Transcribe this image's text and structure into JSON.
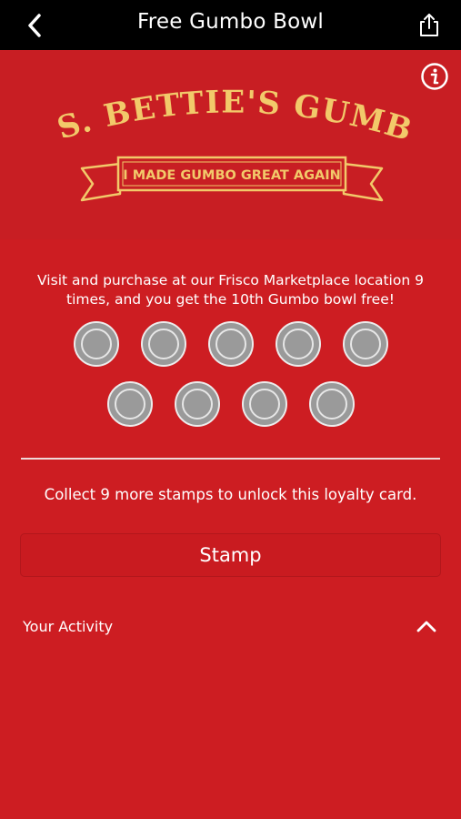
{
  "header": {
    "title": "Free Gumbo Bowl",
    "back_icon": "chevron-left-icon",
    "share_icon": "share-icon"
  },
  "banner": {
    "info_icon": "info-icon",
    "logo": {
      "name": "MS. BETTIE'S GUMBO",
      "tagline": "I MADE GUMBO GREAT AGAIN"
    }
  },
  "card": {
    "description": "Visit and purchase at our Frisco Marketplace location 9 times, and you get the 10th Gumbo bowl free!",
    "stamps_total": 9,
    "stamps_collected": 0,
    "collect_text": "Collect 9 more stamps to unlock this loyalty card.",
    "stamp_button_label": "Stamp"
  },
  "activity": {
    "label": "Your Activity",
    "toggle_icon": "chevron-up-icon"
  },
  "colors": {
    "background": "#cc1f24",
    "topbar": "#000000",
    "logo_gold": "#f2c96a",
    "stamp_empty": "#9a9a9a"
  }
}
